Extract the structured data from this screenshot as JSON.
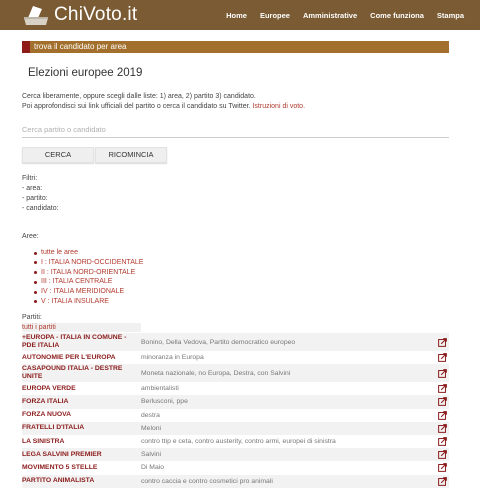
{
  "header": {
    "logo_text": "ChiVoto.it",
    "nav": [
      "Home",
      "Europee",
      "Amministrative",
      "Come funziona",
      "Stampa"
    ]
  },
  "section_title": "trova il candidato per area",
  "page_title": "Elezioni europee 2019",
  "intro": {
    "line1": "Cerca liberamente, oppure scegli dalle liste: 1) area, 2) partito 3) candidato.",
    "line2": "Poi approfondisci sui link ufficiali del partito o cerca il candidato su Twitter.",
    "link": "Istruzioni di voto."
  },
  "search": {
    "placeholder": "Cerca partito o candidato"
  },
  "buttons": {
    "cerca": "CERCA",
    "ricomincia": "RICOMINCIA"
  },
  "filters": {
    "title": "Filtri:",
    "area": "- area:",
    "partito": "- partito:",
    "candidato": "- candidato:"
  },
  "aree": {
    "label": "Aree:",
    "items": [
      "tutte le aree",
      "I : ITALIA NORD-OCCIDENTALE",
      "II : ITALIA NORD-ORIENTALE",
      "III : ITALIA CENTRALE",
      "IV : ITALIA MERIDIONALE",
      "V : ITALIA INSULARE"
    ]
  },
  "partiti": {
    "label": "Partiti:",
    "all": "tutti i partiti",
    "rows": [
      {
        "name": "+EUROPA - ITALIA IN COMUNE - PDE ITALIA",
        "desc": "Bonino, Della Vedova, Partito democratico europeo"
      },
      {
        "name": "AUTONOMIE PER L'EUROPA",
        "desc": "minoranza in Europa"
      },
      {
        "name": "CASAPOUND ITALIA - DESTRE UNITE",
        "desc": "Moneta nazionale, no Europa, Destra, con Salvini"
      },
      {
        "name": "EUROPA VERDE",
        "desc": "ambientalisti"
      },
      {
        "name": "FORZA ITALIA",
        "desc": "Berlusconi, ppe"
      },
      {
        "name": "FORZA NUOVA",
        "desc": "destra"
      },
      {
        "name": "FRATELLI D'ITALIA",
        "desc": "Meloni"
      },
      {
        "name": "LA SINISTRA",
        "desc": "contro ttip e ceta, contro austerity, contro armi, europei di sinistra"
      },
      {
        "name": "LEGA SALVINI PREMIER",
        "desc": "Salvini"
      },
      {
        "name": "MOVIMENTO 5 STELLE",
        "desc": "Di Maio"
      },
      {
        "name": "PARTITO ANIMALISTA",
        "desc": "contro caccia e contro cosmetici pro animali"
      }
    ]
  },
  "colors": {
    "header": "#7a5b33",
    "section_bar": "#a2702c",
    "accent": "#8b1a1a",
    "link": "#b23a2e"
  }
}
